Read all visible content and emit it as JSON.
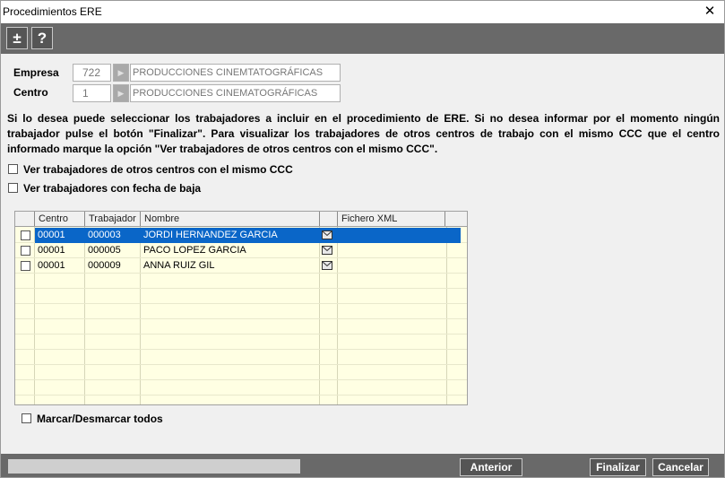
{
  "window": {
    "title": "Procedimientos ERE",
    "close_glyph": "✕"
  },
  "toolbar": {
    "expand_glyph": "±",
    "help_glyph": "?"
  },
  "empresa": {
    "label": "Empresa",
    "code": "722",
    "name": "PRODUCCIONES CINEMTATOGRÁFICAS"
  },
  "centro": {
    "label": "Centro",
    "code": "1",
    "name": "PRODUCCIONES CINEMATOGRÁFICAS"
  },
  "info_text": "Si lo desea puede seleccionar los trabajadores a incluir en el procedimiento de ERE. Si no desea informar por el momento ningún trabajador pulse el botón \"Finalizar\". Para visualizar los trabajadores de otros centros de trabajo con el mismo CCC que el centro informado marque la opción \"Ver trabajadores de otros centros con el mismo CCC\".",
  "options": {
    "other_centers": "Ver trabajadores de otros centros con el mismo CCC",
    "leave_date": "Ver trabajadores con fecha de baja"
  },
  "grid": {
    "columns": {
      "centro": "Centro",
      "trabajador": "Trabajador",
      "nombre": "Nombre",
      "fichero": "Fichero XML"
    },
    "rows": [
      {
        "centro": "00001",
        "trabajador": "000003",
        "nombre": "JORDI HERNANDEZ GARCIA",
        "fichero": "",
        "selected": true
      },
      {
        "centro": "00001",
        "trabajador": "000005",
        "nombre": "PACO LOPEZ GARCIA",
        "fichero": "",
        "selected": false
      },
      {
        "centro": "00001",
        "trabajador": "000009",
        "nombre": "ANNA RUIZ GIL",
        "fichero": "",
        "selected": false
      }
    ]
  },
  "select_all": "Marcar/Desmarcar todos",
  "buttons": {
    "anterior": "Anterior",
    "finalizar": "Finalizar",
    "cancelar": "Cancelar"
  },
  "colors": {
    "toolbar": "#696969",
    "selection": "#0a66c8",
    "grid_bg": "#ffffe3"
  },
  "icons": {
    "row_file": "envelope-icon",
    "arrow": "arrow-right-icon"
  }
}
